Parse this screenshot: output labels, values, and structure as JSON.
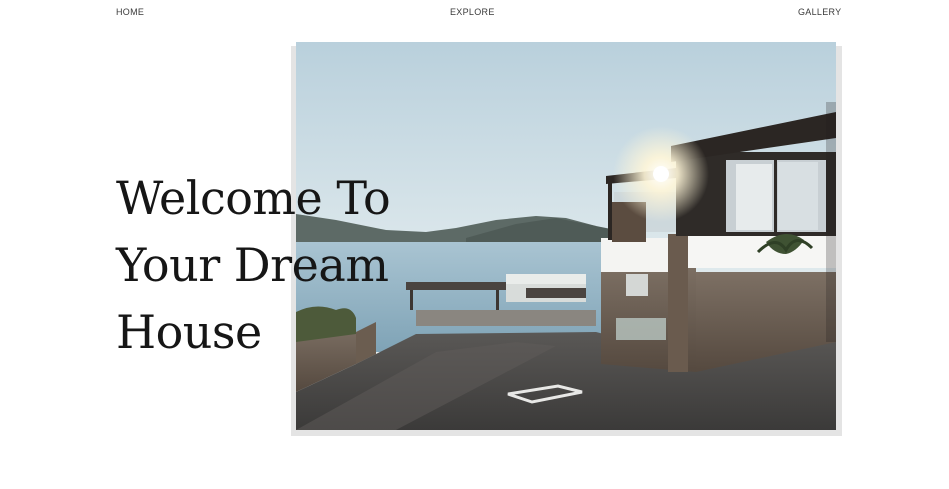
{
  "nav": {
    "items": [
      {
        "label": "HOME"
      },
      {
        "label": "EXPLORE"
      },
      {
        "label": "GALLERY"
      }
    ]
  },
  "hero": {
    "headline_lines": [
      "Welcome To",
      "Your Dream",
      "House"
    ],
    "image_subject": "seaside-villa-photo"
  },
  "colors": {
    "text": "#161616",
    "nav_text": "#3a3a3a",
    "background": "#ffffff",
    "image_shadow": "#e4e4e4"
  }
}
